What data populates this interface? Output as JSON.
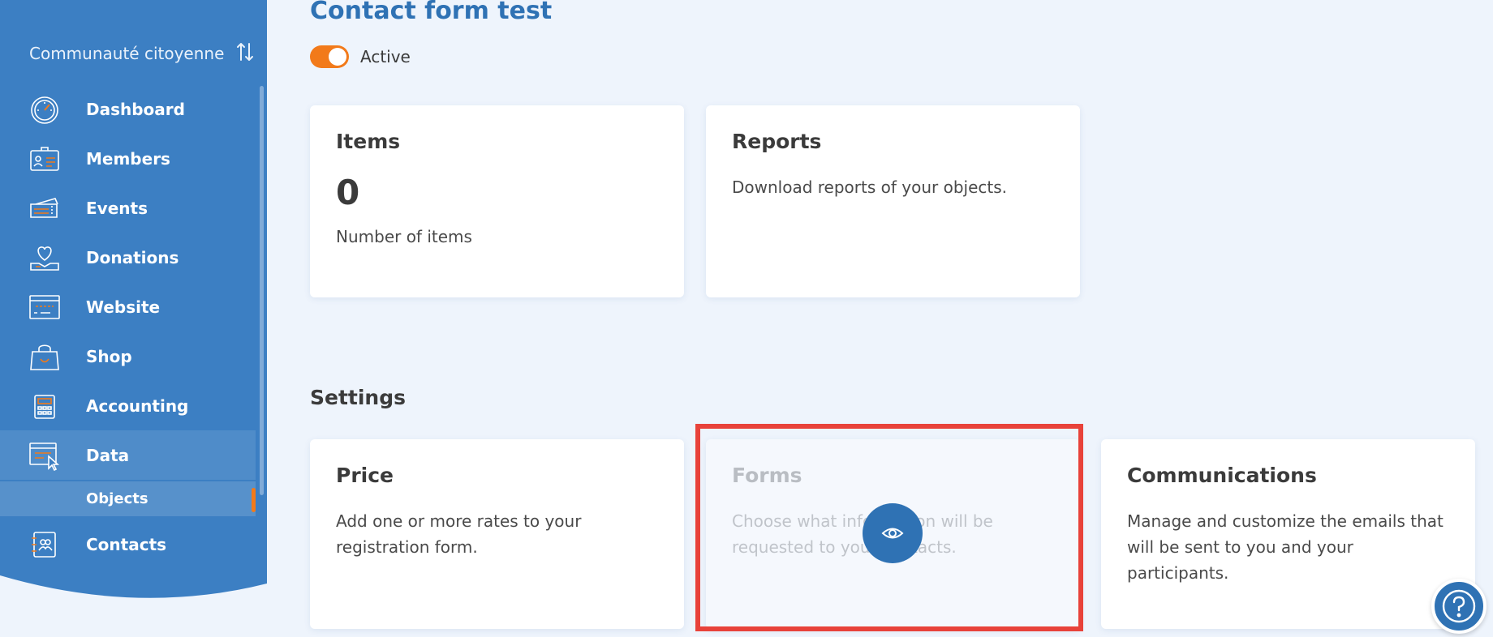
{
  "sidebar": {
    "organization": "Communauté citoyenne",
    "items": [
      {
        "key": "dashboard",
        "label": "Dashboard",
        "icon": "speedometer-icon"
      },
      {
        "key": "members",
        "label": "Members",
        "icon": "id-card-icon"
      },
      {
        "key": "events",
        "label": "Events",
        "icon": "tickets-icon"
      },
      {
        "key": "donations",
        "label": "Donations",
        "icon": "heart-hand-icon"
      },
      {
        "key": "website",
        "label": "Website",
        "icon": "browser-window-icon"
      },
      {
        "key": "shop",
        "label": "Shop",
        "icon": "shopping-bag-icon"
      },
      {
        "key": "accounting",
        "label": "Accounting",
        "icon": "calculator-icon"
      },
      {
        "key": "data",
        "label": "Data",
        "icon": "data-cursor-icon"
      },
      {
        "key": "contacts",
        "label": "Contacts",
        "icon": "address-book-icon"
      }
    ],
    "sub_item": "Objects",
    "colors": {
      "sidebar": "#3c7fc3",
      "accent": "#f27a1a"
    }
  },
  "main": {
    "title": "Contact form test",
    "toggle_label": "Active",
    "cards": {
      "items": {
        "title": "Items",
        "number": "0",
        "caption": "Number of items"
      },
      "reports": {
        "title": "Reports",
        "description": "Download reports of your objects."
      }
    },
    "settings": {
      "title": "Settings",
      "price": {
        "title": "Price",
        "description": "Add one or more rates to your registration form."
      },
      "forms": {
        "title": "Forms",
        "description": "Choose what information will be requested to your contacts."
      },
      "communications": {
        "title": "Communications",
        "description": "Manage and customize the emails that will be sent to you and your participants."
      }
    }
  },
  "colors": {
    "primary": "#2f72b4",
    "highlight": "#e8423a",
    "background": "#eef4fc"
  }
}
